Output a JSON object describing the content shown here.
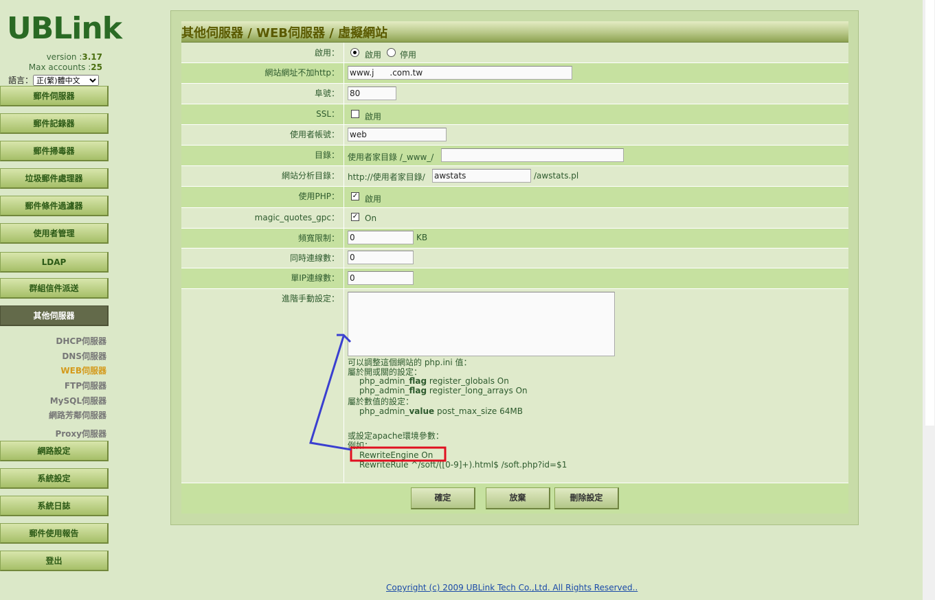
{
  "app": {
    "logo": "UBLink",
    "version_label": "version :",
    "version": "3.17",
    "max_accounts_label": "Max accounts :",
    "max_accounts": "25",
    "language_label": "語言：",
    "language_value": "正(繁)體中文"
  },
  "sidebar": {
    "items": [
      {
        "label": "郵件伺服器"
      },
      {
        "label": "郵件記錄器"
      },
      {
        "label": "郵件掃毒器"
      },
      {
        "label": "垃圾郵件處理器"
      },
      {
        "label": "郵件條件過濾器"
      },
      {
        "label": "使用者管理"
      },
      {
        "label": "LDAP"
      },
      {
        "label": "群組信件派送"
      },
      {
        "label": "其他伺服器"
      },
      {
        "label": "網路設定"
      },
      {
        "label": "系統設定"
      },
      {
        "label": "系統日誌"
      },
      {
        "label": "郵件使用報告"
      },
      {
        "label": "登出"
      }
    ],
    "sub_items": [
      {
        "label": "DHCP伺服器"
      },
      {
        "label": "DNS伺服器"
      },
      {
        "label": "WEB伺服器"
      },
      {
        "label": "FTP伺服器"
      },
      {
        "label": "MySQL伺服器"
      },
      {
        "label": "網路芳鄰伺服器"
      },
      {
        "label": "Proxy伺服器"
      }
    ]
  },
  "page": {
    "title": "其他伺服器 / WEB伺服器 / 虛擬網站"
  },
  "form": {
    "enable": {
      "label": "啟用：",
      "opt_on": "啟用",
      "opt_off": "停用"
    },
    "url": {
      "label": "網站網址不加http：",
      "value": "www.j      .com.tw"
    },
    "port": {
      "label": "阜號：",
      "value": "80"
    },
    "ssl": {
      "label": "SSL：",
      "text": "啟用"
    },
    "user": {
      "label": "使用者帳號：",
      "value": "web"
    },
    "dir": {
      "label": "目錄：",
      "prefix": "使用者家目錄 /_www_/",
      "value": ""
    },
    "stats": {
      "label": "網站分析目錄：",
      "prefix": "http://使用者家目錄/",
      "value": "awstats",
      "suffix": "/awstats.pl"
    },
    "php": {
      "label": "使用PHP：",
      "text": "啟用"
    },
    "magic": {
      "label": "magic_quotes_gpc：",
      "text": "On"
    },
    "bandwidth": {
      "label": "頻寬限制：",
      "value": "0",
      "unit": "KB"
    },
    "conn": {
      "label": "同時連線數：",
      "value": "0"
    },
    "ipconn": {
      "label": "單IP連線數：",
      "value": "0"
    },
    "advanced": {
      "label": "進階手動設定：",
      "value": "",
      "hint": {
        "l1": "可以調整這個網站的 php.ini 值：",
        "l2": "屬於開或關的設定：",
        "l3a": "php_admin_",
        "l3b": "flag",
        "l3c": " register_globals On",
        "l4a": "php_admin_",
        "l4b": "flag",
        "l4c": " register_long_arrays On",
        "l5": "屬於數值的設定：",
        "l6a": "php_admin_",
        "l6b": "value",
        "l6c": " post_max_size 64MB",
        "l7": "或設定apache環境參數：",
        "l8": "例如：",
        "l9": "RewriteEngine On",
        "l10": "RewriteRule ^/soft/([0-9]+).html$ /soft.php?id=$1"
      }
    }
  },
  "buttons": {
    "ok": "確定",
    "cancel": "放棄",
    "delete": "刪除設定"
  },
  "footer": "Copyright (c) 2009 UBLink Tech Co.,Ltd. All Rights Reserved..",
  "colors": {
    "highlight_box": "#e01020",
    "annotation_arrow": "#3a3fd0",
    "accent": "#2a6a24"
  }
}
